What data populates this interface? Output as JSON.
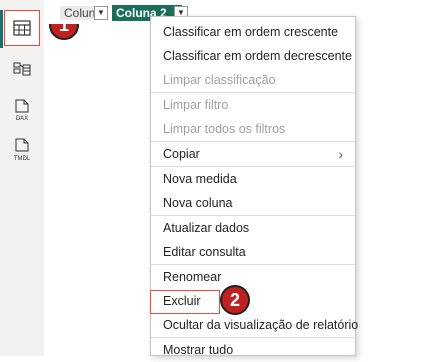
{
  "rail": {
    "items": [
      {
        "icon": "table-view-icon",
        "label": ""
      },
      {
        "icon": "model-view-icon",
        "label": ""
      },
      {
        "icon": "dax-query-icon",
        "label": "DAX"
      },
      {
        "icon": "tmdl-view-icon",
        "label": "TMDL"
      }
    ]
  },
  "annotations": {
    "badge1": "1",
    "badge2": "2"
  },
  "columns": {
    "col1_label": "Coluna",
    "col2_label": "Coluna 2"
  },
  "menu": {
    "items": [
      {
        "label": "Classificar em ordem crescente",
        "disabled": false
      },
      {
        "label": "Classificar em ordem decrescente",
        "disabled": false
      },
      {
        "label": "Limpar classificação",
        "disabled": true
      },
      {
        "label": "Limpar filtro",
        "disabled": true
      },
      {
        "label": "Limpar todos os filtros",
        "disabled": true
      },
      {
        "label": "Copiar",
        "disabled": false,
        "submenu": true
      },
      {
        "label": "Nova medida",
        "disabled": false
      },
      {
        "label": "Nova coluna",
        "disabled": false
      },
      {
        "label": "Atualizar dados",
        "disabled": false
      },
      {
        "label": "Editar consulta",
        "disabled": false
      },
      {
        "label": "Renomear",
        "disabled": false
      },
      {
        "label": "Excluir",
        "disabled": false
      },
      {
        "label": "Ocultar da visualização de relatório",
        "disabled": false
      },
      {
        "label": "Mostrar tudo",
        "disabled": false
      }
    ]
  },
  "colors": {
    "accent": "#1b6e5b",
    "highlight": "#e74c3c",
    "badge": "#c0201f"
  }
}
